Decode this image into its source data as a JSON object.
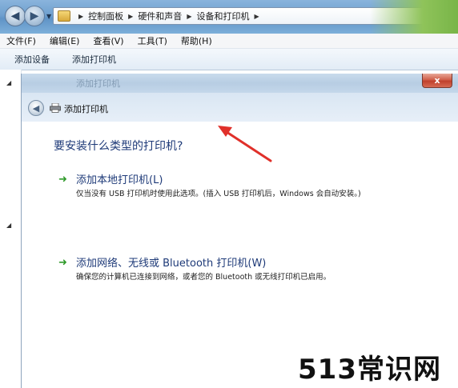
{
  "address_bar": {
    "breadcrumbs": [
      "控制面板",
      "硬件和声音",
      "设备和打印机"
    ]
  },
  "menu": [
    "文件(F)",
    "编辑(E)",
    "查看(V)",
    "工具(T)",
    "帮助(H)"
  ],
  "toolbar": {
    "add_device": "添加设备",
    "add_printer": "添加打印机"
  },
  "dialog": {
    "title": "添加打印机",
    "close_glyph": "x",
    "question": "要安装什么类型的打印机?",
    "options": [
      {
        "title": "添加本地打印机(L)",
        "description": "仅当没有 USB 打印机时使用此选项。(插入 USB 打印机后，Windows 会自动安装。)"
      },
      {
        "title": "添加网络、无线或 Bluetooth 打印机(W)",
        "description": "确保您的计算机已连接到网络，或者您的 Bluetooth 或无线打印机已启用。"
      }
    ]
  },
  "watermark": "513常识网",
  "colors": {
    "link_blue": "#1e3a78",
    "green_arrow": "#2f9a2a",
    "annotation_red": "#e0302a"
  }
}
